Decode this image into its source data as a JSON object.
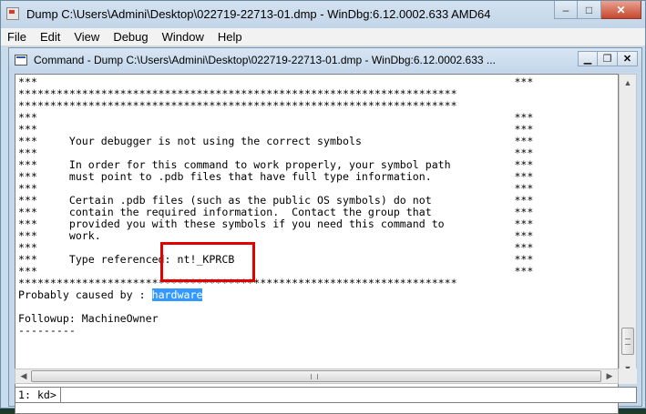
{
  "window": {
    "title": "Dump C:\\Users\\Admini\\Desktop\\022719-22713-01.dmp - WinDbg:6.12.0002.633 AMD64",
    "controls": {
      "minimize": "–",
      "maximize": "□",
      "close": "✕"
    }
  },
  "menu": {
    "items": [
      "File",
      "Edit",
      "View",
      "Debug",
      "Window",
      "Help"
    ]
  },
  "command_window": {
    "title": "Command - Dump C:\\Users\\Admini\\Desktop\\022719-22713-01.dmp - WinDbg:6.12.0002.633 ...",
    "controls": {
      "minimize": "▁",
      "restore": "❐",
      "close": "✕"
    },
    "output_lines": [
      "***                                                                           ***",
      "*********************************************************************",
      "*********************************************************************",
      "***                                                                           ***",
      "***                                                                           ***",
      "***     Your debugger is not using the correct symbols                        ***",
      "***                                                                           ***",
      "***     In order for this command to work properly, your symbol path          ***",
      "***     must point to .pdb files that have full type information.             ***",
      "***                                                                           ***",
      "***     Certain .pdb files (such as the public OS symbols) do not             ***",
      "***     contain the required information.  Contact the group that             ***",
      "***     provided you with these symbols if you need this command to           ***",
      "***     work.                                                                 ***",
      "***                                                                           ***",
      "***     Type referenced: nt!_KPRCB                                            ***",
      "***                                                                           ***",
      "*********************************************************************"
    ],
    "probably_caused_by_label": "Probably caused by : ",
    "probably_caused_by_value": "hardware",
    "blank_line": "",
    "followup_line": "Followup: MachineOwner",
    "dashes_line": "---------",
    "prompt": "1: kd>",
    "command_value": ""
  }
}
